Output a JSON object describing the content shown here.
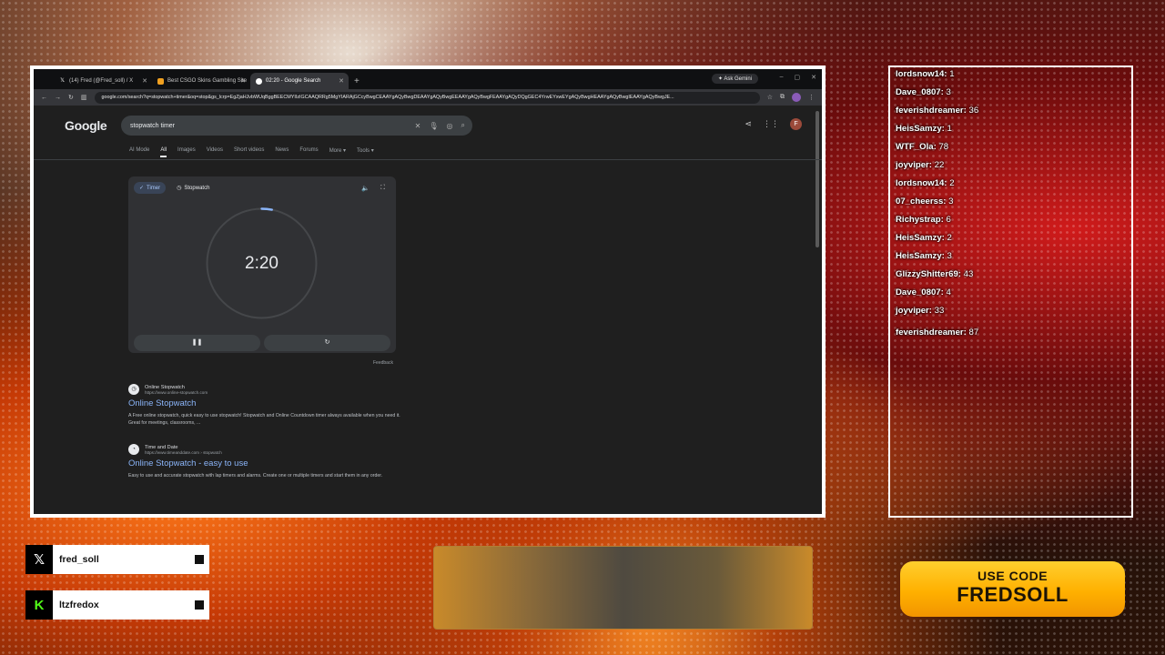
{
  "browser": {
    "tabs": [
      {
        "label": "(14) Fred (@Fred_soll) / X",
        "icon": "x-logo-icon",
        "active": false
      },
      {
        "label": "Best CSGO Skins Gambling Site",
        "icon": "site-icon",
        "active": false
      },
      {
        "label": "02:20 - Google Search",
        "icon": "google-icon",
        "active": true
      }
    ],
    "new_tab": "+",
    "gemini_label": "Ask Gemini",
    "url": "google.com/search?q=stopwatch+timer&oq=stop&gs_lcrp=EgZjaHJvbWUqBggBEECMYIIzIGCAAQRRg5MgYIARAjGCcyBwgCEAAYgAQyBwgDEAAYgAQyBwgEEAAYgAQyBwgFEAAYgAQyDQgGEC4YrwEYxwEYgAQyBwgHEAAYgAQyBwgIEAAYgAQyBwgJE..."
  },
  "google": {
    "logo": "Google",
    "query": "stopwatch timer",
    "profile_initial": "F",
    "filters": [
      "AI Mode",
      "All",
      "Images",
      "Videos",
      "Short videos",
      "News",
      "Forums",
      "More ▾",
      "Tools ▾"
    ],
    "active_filter": "All",
    "widget": {
      "tab_timer": "Timer",
      "tab_stopwatch": "Stopwatch",
      "time": "2:20",
      "progress": 0.03,
      "feedback": "Feedback"
    },
    "results": [
      {
        "site": "Online Stopwatch",
        "url": "https://www.online-stopwatch.com",
        "title": "Online Stopwatch",
        "snippet": "A Free online stopwatch, quick easy to use stopwatch! Stopwatch and Online Countdown timer always available when you need it. Great for meetings, classrooms, ..."
      },
      {
        "site": "Time and Date",
        "url": "https://www.timeanddate.com › stopwatch",
        "title": "Online Stopwatch - easy to use",
        "snippet": "Easy to use and accurate stopwatch with lap timers and alarms. Create one or multiple timers and start them in any order."
      }
    ]
  },
  "chat": [
    {
      "user": "lordsnow14:",
      "msg": "1"
    },
    {
      "user": "Dave_0807:",
      "msg": "3"
    },
    {
      "user": "feverishdreamer:",
      "msg": "36"
    },
    {
      "user": "HeisSamzy:",
      "msg": "1"
    },
    {
      "user": "WTF_Ola:",
      "msg": "78"
    },
    {
      "user": "joyviper:",
      "msg": "22"
    },
    {
      "user": "lordsnow14:",
      "msg": "2"
    },
    {
      "user": "07_cheerss:",
      "msg": "3"
    },
    {
      "user": "Richystrap:",
      "msg": "6"
    },
    {
      "user": "HeisSamzy:",
      "msg": "2"
    },
    {
      "user": "HeisSamzy:",
      "msg": "3"
    },
    {
      "user": "GlizzyShitter69:",
      "msg": "43"
    },
    {
      "user": "Dave_0807:",
      "msg": "4"
    },
    {
      "user": "joyviper:",
      "msg": "33"
    },
    {
      "user": "feverishdreamer:",
      "msg": "87"
    }
  ],
  "socials": [
    {
      "platform_icon": "x-logo-icon",
      "handle": "fred_soll",
      "icon_bg": "#000000",
      "icon_color": "#ffffff"
    },
    {
      "platform_icon": "kick-logo-icon",
      "handle": "ltzfredox",
      "icon_bg": "#000000",
      "icon_color": "#53fc18"
    }
  ],
  "promo": {
    "line1": "USE CODE",
    "line2": "FREDSOLL"
  },
  "colors": {
    "browser_border": "#ffffff",
    "link": "#8ab4f8",
    "kick_green": "#53fc18",
    "code_yellow": "#ffb000"
  }
}
